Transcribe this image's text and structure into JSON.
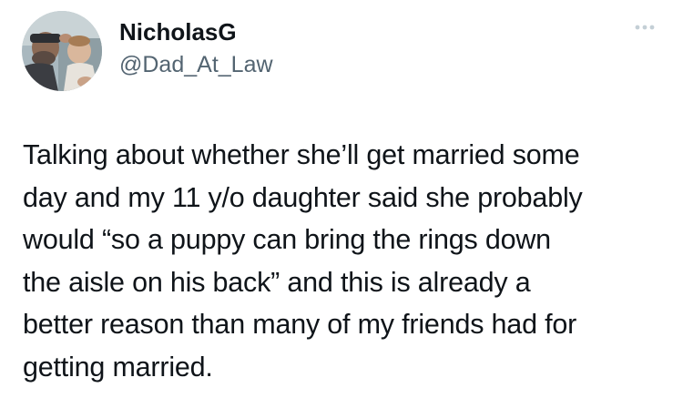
{
  "tweet": {
    "author": {
      "display_name": "NicholasG",
      "handle": "@Dad_At_Law"
    },
    "text": "Talking about whether she’ll get married some\nday and my 11 y/o daughter said she probably\nwould “so a puppy can bring the rings down\nthe aisle on his back” and this is already a\nbetter reason than many of my friends had for\ngetting married."
  },
  "colors": {
    "text_primary": "#0f1419",
    "text_secondary": "#536471",
    "icon_muted": "#c4cfd6"
  },
  "icons": {
    "more": "more-dots-icon"
  }
}
